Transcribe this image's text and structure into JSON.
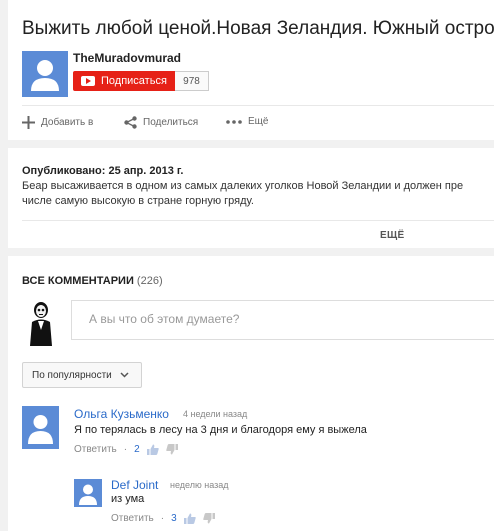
{
  "video": {
    "title": "Выжить любой ценой.Новая Зеландия. Южный остров"
  },
  "channel": {
    "name": "TheMuradovmurad",
    "subscribe_label": "Подписаться",
    "subscriber_count": "978"
  },
  "actions": {
    "add_label": "Добавить в",
    "share_label": "Поделиться",
    "more_label": "Ещё"
  },
  "description": {
    "published": "Опубликовано: 25 апр. 2013 г.",
    "line1": "Беар высаживается в одном из самых далеких уголков Новой Зеландии и должен пре",
    "line2": "числе самую высокую в стране горную гряду.",
    "more_label": "ЕЩЁ"
  },
  "comments": {
    "header_label": "ВСЕ КОММЕНТАРИИ",
    "count": "(226)",
    "input_placeholder": "А вы что об этом думаете?",
    "sort_label": "По популярности",
    "items": [
      {
        "author": "Ольга Кузьменко",
        "time": "4 недели назад",
        "text": "Я по терялась в лесу на 3 дня и благодоря ему я выжела",
        "reply_label": "Ответить",
        "separator": "·",
        "likes": "2"
      },
      {
        "author": "Def Joint",
        "time": "неделю назад",
        "text": "из ума",
        "reply_label": "Ответить",
        "separator": "·",
        "likes": "3"
      }
    ]
  },
  "colors": {
    "subscribe_red": "#e62117",
    "link_blue": "#2a6ac9",
    "avatar_blue": "#5b8bd6"
  }
}
